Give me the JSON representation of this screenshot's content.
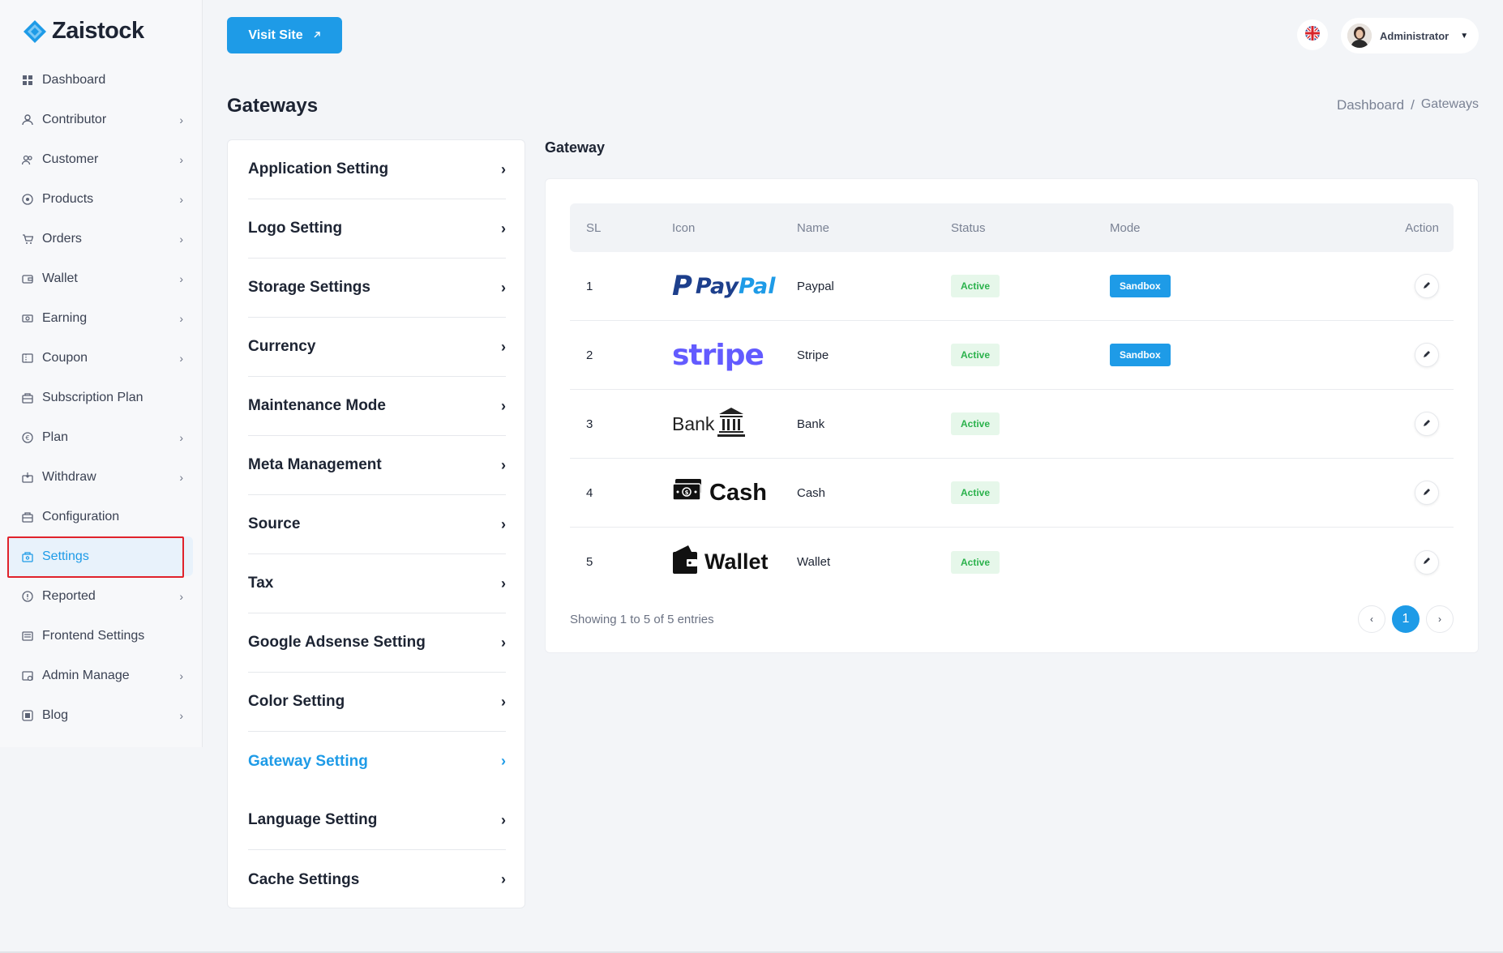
{
  "brand": {
    "name": "Zaistock"
  },
  "header": {
    "visit_site_label": "Visit Site",
    "user_name": "Administrator"
  },
  "sidebar": {
    "items": [
      {
        "label": "Dashboard",
        "icon": "grid-icon",
        "has_chevron": false
      },
      {
        "label": "Contributor",
        "icon": "user-icon",
        "has_chevron": true
      },
      {
        "label": "Customer",
        "icon": "users-icon",
        "has_chevron": true
      },
      {
        "label": "Products",
        "icon": "product-icon",
        "has_chevron": true
      },
      {
        "label": "Orders",
        "icon": "cart-icon",
        "has_chevron": true
      },
      {
        "label": "Wallet",
        "icon": "wallet-icon",
        "has_chevron": true
      },
      {
        "label": "Earning",
        "icon": "money-icon",
        "has_chevron": true
      },
      {
        "label": "Coupon",
        "icon": "coupon-icon",
        "has_chevron": true
      },
      {
        "label": "Subscription Plan",
        "icon": "subscription-icon",
        "has_chevron": false
      },
      {
        "label": "Plan",
        "icon": "plan-icon",
        "has_chevron": true
      },
      {
        "label": "Withdraw",
        "icon": "withdraw-icon",
        "has_chevron": true
      },
      {
        "label": "Configuration",
        "icon": "config-icon",
        "has_chevron": false
      },
      {
        "label": "Settings",
        "icon": "settings-icon",
        "has_chevron": false,
        "active": true
      },
      {
        "label": "Reported",
        "icon": "report-icon",
        "has_chevron": true
      },
      {
        "label": "Frontend Settings",
        "icon": "frontend-icon",
        "has_chevron": false
      },
      {
        "label": "Admin Manage",
        "icon": "admin-icon",
        "has_chevron": true
      },
      {
        "label": "Blog",
        "icon": "blog-icon",
        "has_chevron": true
      }
    ]
  },
  "page": {
    "title": "Gateways",
    "breadcrumb": [
      "Dashboard",
      "/",
      "Gateways"
    ]
  },
  "settings_menu": {
    "items": [
      {
        "label": "Application Setting"
      },
      {
        "label": "Logo Setting"
      },
      {
        "label": "Storage Settings"
      },
      {
        "label": "Currency"
      },
      {
        "label": "Maintenance Mode"
      },
      {
        "label": "Meta Management"
      },
      {
        "label": "Source"
      },
      {
        "label": "Tax"
      },
      {
        "label": "Google Adsense Setting"
      },
      {
        "label": "Color Setting"
      },
      {
        "label": "Gateway Setting",
        "active": true
      },
      {
        "label": "Language Setting"
      },
      {
        "label": "Cache Settings"
      }
    ]
  },
  "gateway": {
    "title": "Gateway",
    "columns": [
      "SL",
      "Icon",
      "Name",
      "Status",
      "Mode",
      "Action"
    ],
    "rows": [
      {
        "sl": "1",
        "logo": "paypal",
        "logo_text_a": "Pay",
        "logo_text_b": "Pal",
        "name": "Paypal",
        "status": "Active",
        "mode": "Sandbox"
      },
      {
        "sl": "2",
        "logo": "stripe",
        "logo_text_a": "stripe",
        "name": "Stripe",
        "status": "Active",
        "mode": "Sandbox"
      },
      {
        "sl": "3",
        "logo": "bank",
        "logo_text_a": "Bank",
        "name": "Bank",
        "status": "Active",
        "mode": ""
      },
      {
        "sl": "4",
        "logo": "cash",
        "logo_text_a": "Cash",
        "name": "Cash",
        "status": "Active",
        "mode": ""
      },
      {
        "sl": "5",
        "logo": "wallet",
        "logo_text_a": "Wallet",
        "name": "Wallet",
        "status": "Active",
        "mode": ""
      }
    ],
    "entries_text": "Showing 1 to 5 of 5 entries",
    "pagination": {
      "prev": "‹",
      "current": "1",
      "next": "›"
    }
  },
  "colors": {
    "accent": "#1e9be7",
    "highlight": "#e0222b",
    "active_badge_bg": "#e6f7ea",
    "active_badge_text": "#2bb24c"
  }
}
